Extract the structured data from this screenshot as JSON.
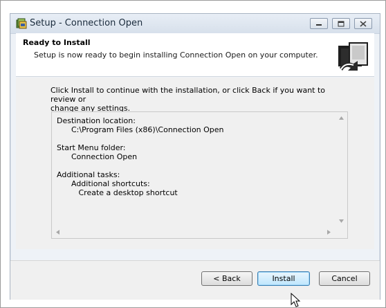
{
  "window": {
    "title": "Setup - Connection Open"
  },
  "header": {
    "title": "Ready to Install",
    "subtitle": "Setup is now ready to begin installing Connection Open on your computer."
  },
  "body": {
    "intro_line1": "Click Install to continue with the installation, or click Back if you want to review or",
    "intro_line2": "change any settings.",
    "memo": {
      "dest_label": "Destination location:",
      "dest_value": "C:\\Program Files (x86)\\Connection Open",
      "menu_label": "Start Menu folder:",
      "menu_value": "Connection Open",
      "tasks_label": "Additional tasks:",
      "tasks_group": "Additional shortcuts:",
      "tasks_item": "Create a desktop shortcut"
    }
  },
  "buttons": {
    "back": "< Back",
    "install": "Install",
    "cancel": "Cancel"
  },
  "icons": {
    "app": "setup-app-icon",
    "header": "install-box-icon",
    "minimize": "minimize-icon",
    "maximize": "maximize-icon",
    "close": "close-icon"
  },
  "colors": {
    "titlebar": "#dbe3ed",
    "install_accent": "#3c7fb1"
  }
}
